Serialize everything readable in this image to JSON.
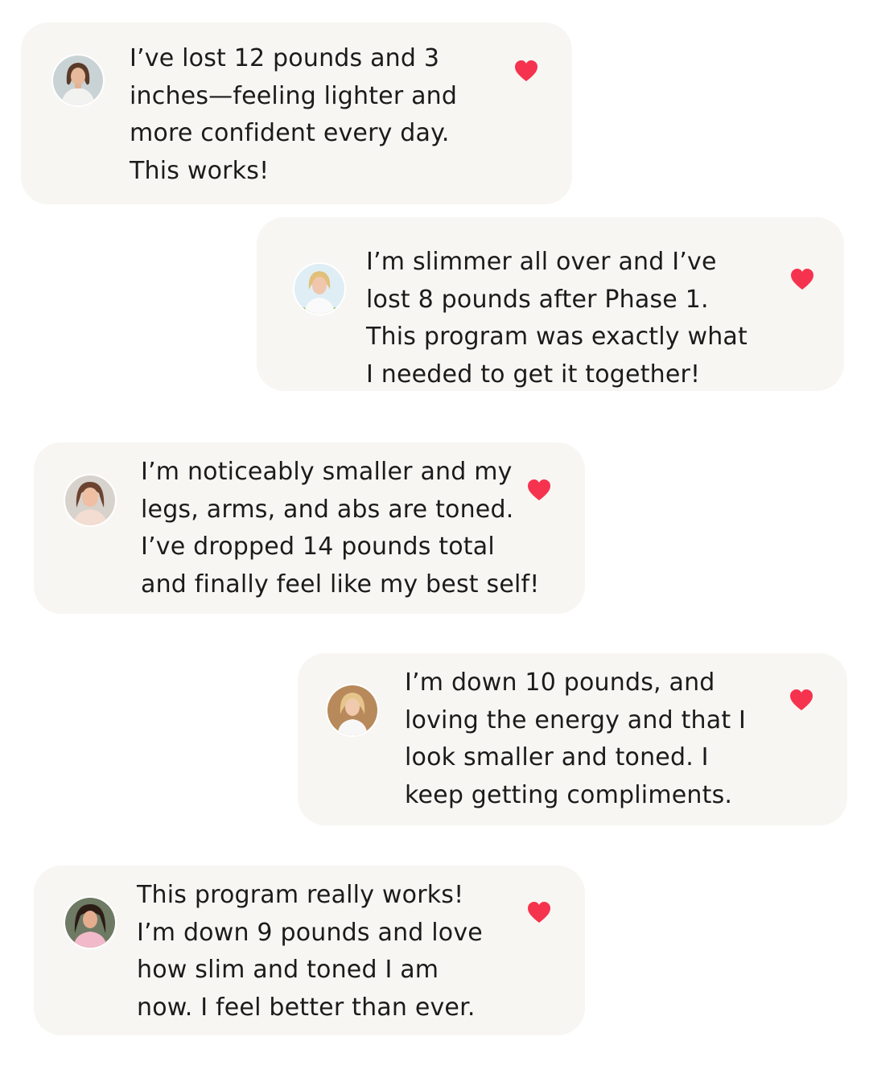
{
  "accent_color": "#f5334f",
  "bubble_color": "#f7f6f3",
  "testimonials": [
    {
      "lines": [
        "I’ve lost 12 pounds and 3",
        "inches—feeling lighter and",
        "more confident every day.",
        "This works!"
      ],
      "avatar_icon": "woman-portrait-avatar",
      "reaction_icon": "heart-icon"
    },
    {
      "lines": [
        "I’m slimmer all over and I’ve",
        "lost 8 pounds after Phase 1.",
        "This program was exactly what",
        "I needed to get it together!"
      ],
      "avatar_icon": "woman-portrait-avatar",
      "reaction_icon": "heart-icon"
    },
    {
      "lines": [
        "I’m noticeably smaller and my",
        "legs, arms, and abs are toned.",
        "I’ve dropped 14 pounds total",
        "and finally feel like my best self!"
      ],
      "avatar_icon": "woman-portrait-avatar",
      "reaction_icon": "heart-icon"
    },
    {
      "lines": [
        "I’m down 10 pounds, and",
        "loving the energy and that I",
        "look smaller and toned. I",
        "keep getting compliments."
      ],
      "avatar_icon": "woman-portrait-avatar",
      "reaction_icon": "heart-icon"
    },
    {
      "lines": [
        "This program really works!",
        "I’m down 9 pounds and love",
        "how slim and toned I am",
        "now.  I feel better than ever."
      ],
      "avatar_icon": "woman-portrait-avatar",
      "reaction_icon": "heart-icon"
    }
  ]
}
